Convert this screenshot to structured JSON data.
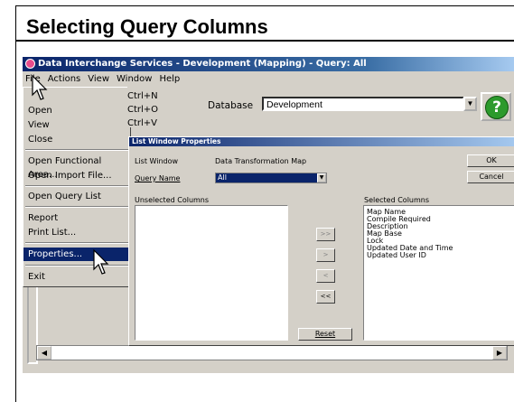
{
  "slide": {
    "title": "Selecting Query Columns"
  },
  "window": {
    "title": "Data Interchange Services - Development (Mapping) - Query: All",
    "menu": [
      "File",
      "Actions",
      "View",
      "Window",
      "Help"
    ]
  },
  "database": {
    "label": "Database",
    "value": "Development"
  },
  "help_button": {
    "glyph": "?"
  },
  "file_menu": {
    "items": [
      {
        "label": "Open",
        "shortcut": "Ctrl+O"
      },
      {
        "label": "View",
        "shortcut": "Ctrl+V"
      },
      {
        "label": "Close",
        "shortcut": ""
      },
      {
        "label": "Open Functional Area...",
        "shortcut": ""
      },
      {
        "label": "Open Import File...",
        "shortcut": ""
      },
      {
        "label": "Open Query List",
        "shortcut": ""
      },
      {
        "label": "Report",
        "shortcut": ""
      },
      {
        "label": "Print List...",
        "shortcut": ""
      },
      {
        "label": "Properties...",
        "shortcut": ""
      },
      {
        "label": "Exit",
        "shortcut": ""
      }
    ],
    "first_shortcut": "Ctrl+N",
    "highlighted": "Properties..."
  },
  "dialog": {
    "title": "List Window Properties",
    "list_window_label": "List Window",
    "list_window_value": "Data Transformation Map",
    "query_name_label": "Query Name",
    "query_name_value": "All",
    "ok": "OK",
    "cancel": "Cancel",
    "unselected_label": "Unselected Columns",
    "selected_label": "Selected Columns",
    "selected_columns": [
      "Map Name",
      "Compile Required",
      "Description",
      "Map Base",
      "Lock",
      "Updated Date and Time",
      "Updated User ID"
    ],
    "move_buttons": [
      ">>",
      ">",
      "<",
      "<<"
    ],
    "reset": "Reset"
  },
  "colors": {
    "titlebar": "#0a246a",
    "highlight": "#0a246a",
    "dialog_bg": "#d4d0c8"
  }
}
